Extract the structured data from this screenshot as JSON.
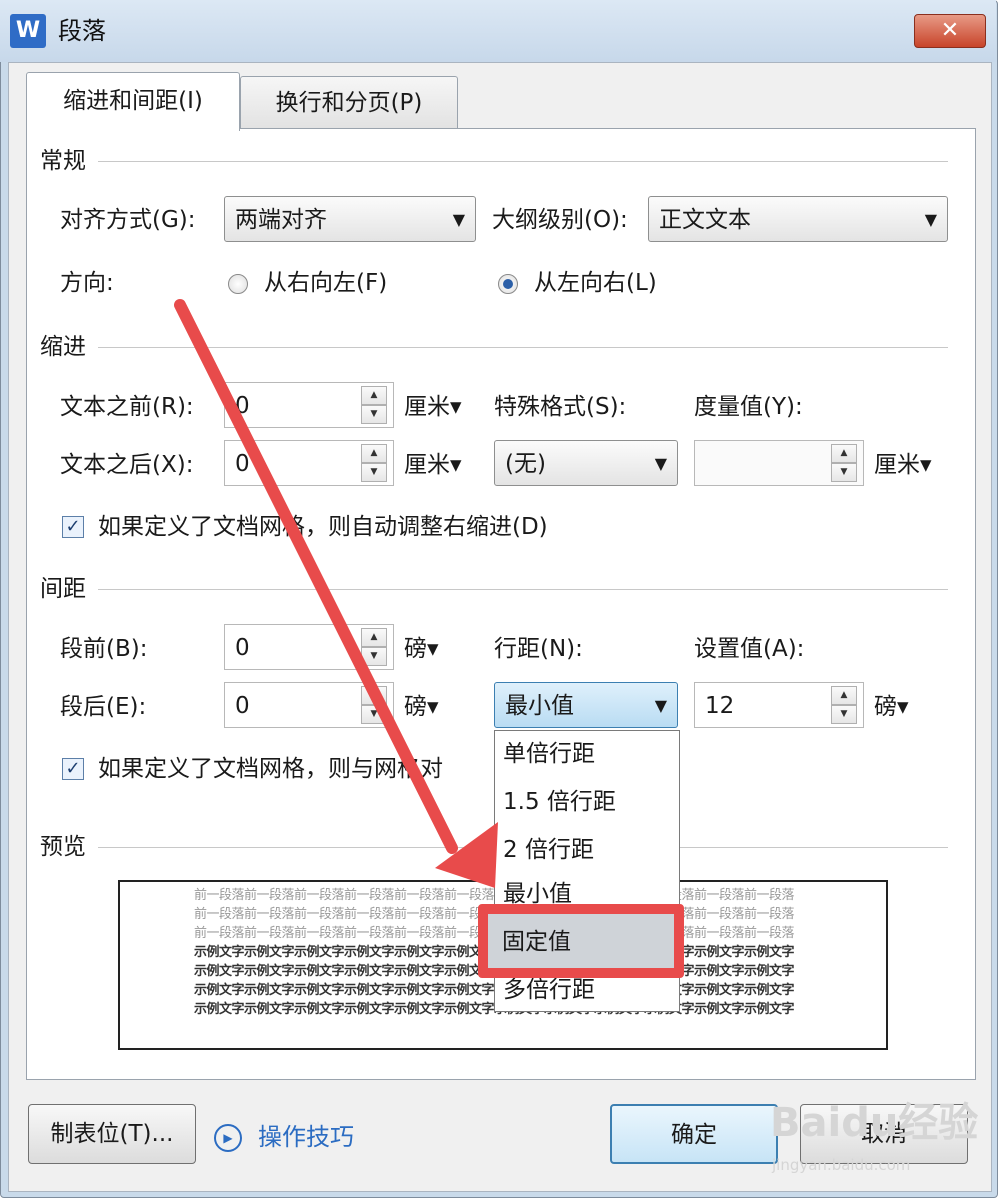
{
  "window": {
    "title": "段落",
    "app_icon": "W",
    "close": "✕"
  },
  "tabs": {
    "indent": "缩进和间距(I)",
    "linebreak": "换行和分页(P)"
  },
  "general": {
    "section": "常规",
    "align_label": "对齐方式(G):",
    "align_value": "两端对齐",
    "outline_label": "大纲级别(O):",
    "outline_value": "正文文本",
    "direction_label": "方向:",
    "rtl_label": "从右向左(F)",
    "ltr_label": "从左向右(L)",
    "direction_selected": "ltr"
  },
  "indent": {
    "section": "缩进",
    "before_label": "文本之前(R):",
    "before_value": "0",
    "after_label": "文本之后(X):",
    "after_value": "0",
    "unit": "厘米▾",
    "special_label": "特殊格式(S):",
    "special_value": "(无)",
    "measure_label": "度量值(Y):",
    "measure_value": "",
    "grid_check_label": "如果定义了文档网格，则自动调整右缩进(D)",
    "grid_checked": true
  },
  "spacing": {
    "section": "间距",
    "before_label": "段前(B):",
    "before_value": "0",
    "after_label": "段后(E):",
    "after_value": "0",
    "unit": "磅▾",
    "line_label": "行距(N):",
    "line_value": "最小值",
    "setting_label": "设置值(A):",
    "setting_value": "12",
    "grid_check_label": "如果定义了文档网格，则与网格对",
    "grid_checked": true
  },
  "line_spacing_options": [
    "单倍行距",
    "1.5 倍行距",
    "2 倍行距",
    "最小值",
    "固定值",
    "多倍行距"
  ],
  "line_spacing_highlighted": "固定值",
  "preview": {
    "section": "预览",
    "prev_text": "前一段落前一段落前一段落前一段落前一段落前一段落前一段落前一段落前一段落前一段落前一段落前一段落",
    "sample_text": "示例文字示例文字示例文字示例文字示例文字示例文字示例文字示例文字示例文字示例文字示例文字示例文字"
  },
  "buttons": {
    "tabs_button": "制表位(T)...",
    "tips_link": "操作技巧",
    "ok": "确定",
    "cancel": "取消"
  },
  "watermark": {
    "text": "Baidu经验",
    "url": "jingyan.baidu.com"
  },
  "colors": {
    "annotation_red": "#e84b4b",
    "link_blue": "#2b6cc2",
    "ok_border": "#3c7fb1"
  }
}
